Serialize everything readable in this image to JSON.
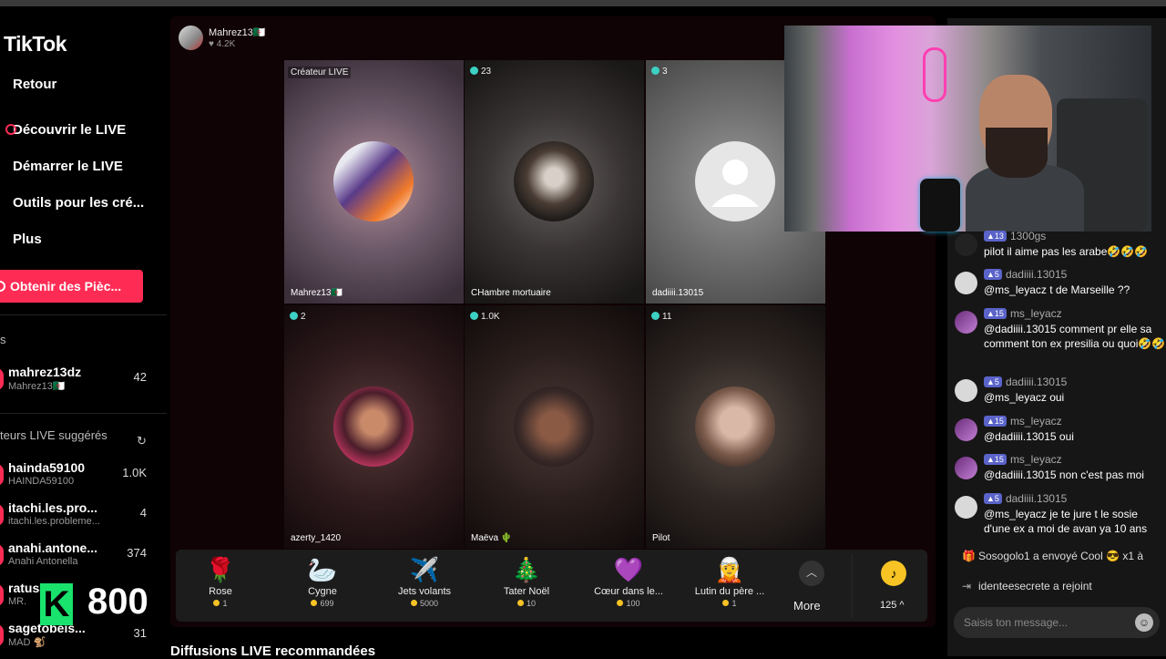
{
  "app": {
    "logo": "TikTok"
  },
  "nav": [
    {
      "label": "Retour"
    },
    {
      "label": "Découvrir le LIVE"
    },
    {
      "label": "Démarrer le LIVE"
    },
    {
      "label": "Outils pour les cré..."
    },
    {
      "label": "Plus"
    }
  ],
  "coins_button": {
    "label": "Obtenir des Pièc..."
  },
  "following": {
    "title": "s",
    "accounts": [
      {
        "name": "mahrez13dz",
        "sub": "Mahrez13🇩🇿",
        "count": "42"
      }
    ]
  },
  "suggested": {
    "title": "teurs LIVE suggérés",
    "accounts": [
      {
        "name": "hainda59100",
        "sub": "HAINDA59100",
        "count": "1.0K"
      },
      {
        "name": "itachi.les.pro...",
        "sub": "itachi.les.probleme...",
        "count": "4"
      },
      {
        "name": "anahi.antone...",
        "sub": "Anahi Antonella",
        "count": "374"
      },
      {
        "name": "ratus3a01",
        "sub": "MR.",
        "count": ""
      },
      {
        "name": "sagetobeis...",
        "sub": "MAD 🐒",
        "count": "31"
      }
    ]
  },
  "overlay": {
    "letter": "K",
    "value": "800"
  },
  "host": {
    "name": "Mahrez13🇩🇿",
    "likes": "♥ 4.2K"
  },
  "grid": [
    {
      "tag": "Créateur LIVE",
      "badge": false,
      "label": "Mahrez13🇩🇿"
    },
    {
      "tag": "23",
      "badge": true,
      "label": "CHambre mortuaire"
    },
    {
      "tag": "3",
      "badge": true,
      "label": "dadiiii.13015"
    },
    {
      "tag": "2",
      "badge": true,
      "label": "azerty_1420"
    },
    {
      "tag": "1.0K",
      "badge": true,
      "label": "Maëva 🌵"
    },
    {
      "tag": "11",
      "badge": true,
      "label": "Pilot"
    }
  ],
  "gifts": [
    {
      "icon": "🌹",
      "name": "Rose",
      "price": "1"
    },
    {
      "icon": "🦢",
      "name": "Cygne",
      "price": "699"
    },
    {
      "icon": "✈️",
      "name": "Jets volants",
      "price": "5000"
    },
    {
      "icon": "🎄",
      "name": "Tater Noël",
      "price": "10"
    },
    {
      "icon": "💜",
      "name": "Cœur dans le...",
      "price": "100"
    },
    {
      "icon": "🧝",
      "name": "Lutin du père ...",
      "price": "1"
    }
  ],
  "more": {
    "label": "More"
  },
  "coin_balance": "125 ^",
  "recommended_title": "Diffusions LIVE recommandées",
  "chat": {
    "messages": [
      {
        "level": "13",
        "user": "1300gs",
        "text": "pilot il aime pas les arabe🤣🤣🤣",
        "avatar": "dark"
      },
      {
        "level": "5",
        "user": "dadiiii.13015",
        "text": "@ms_leyacz t de Marseille ??",
        "avatar": "gray"
      },
      {
        "level": "15",
        "user": "ms_leyacz",
        "text": "@dadiiii.13015 comment pr elle sa comment ton ex presilia ou quoi🤣🤣",
        "avatar": "purple"
      },
      {
        "level": "5",
        "user": "dadiiii.13015",
        "text": "@ms_leyacz oui",
        "avatar": "gray"
      },
      {
        "level": "15",
        "user": "ms_leyacz",
        "text": "@dadiiii.13015 oui",
        "avatar": "purple"
      },
      {
        "level": "15",
        "user": "ms_leyacz",
        "text": "@dadiiii.13015 non c'est pas moi",
        "avatar": "purple"
      },
      {
        "level": "5",
        "user": "dadiiii.13015",
        "text": "@ms_leyacz je te jure t le sosie d'une ex a moi de avan ya 10 ans",
        "avatar": "gray"
      }
    ],
    "events": [
      {
        "icon": "🎁",
        "text": "Sosogolo1 a envoyé Cool 😎 x1 à"
      },
      {
        "icon": "⇥",
        "text": "identeesecrete  a rejoint"
      }
    ],
    "input_placeholder": "Saisis ton message...",
    "emoji_icon": "☺"
  }
}
